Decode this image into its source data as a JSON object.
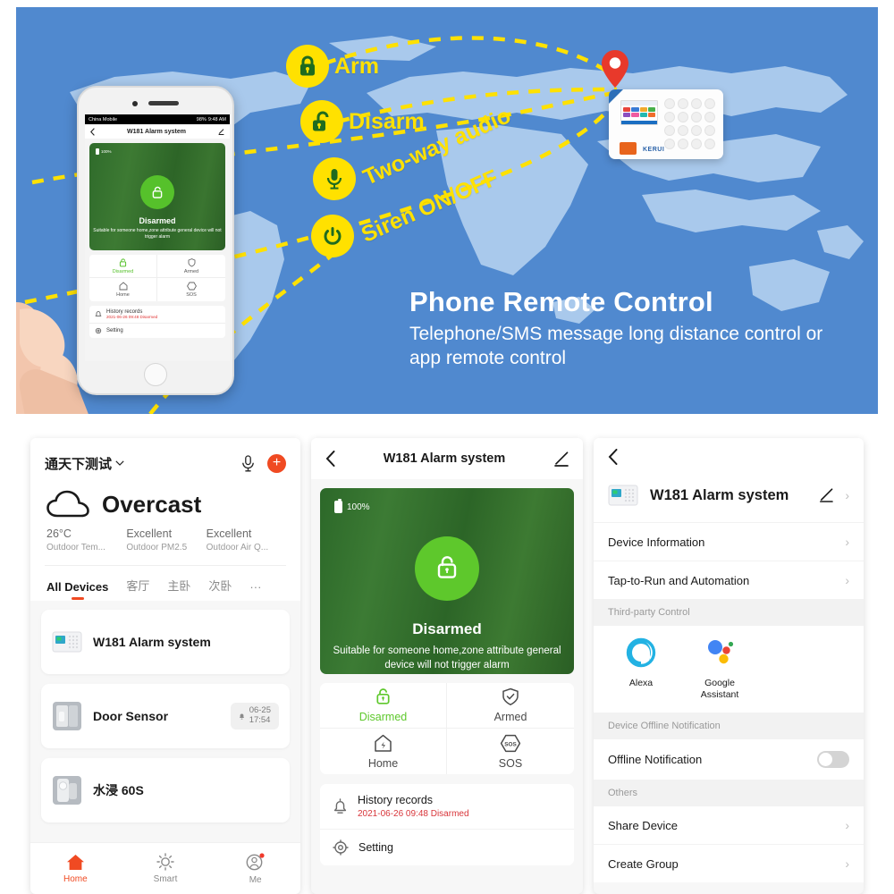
{
  "banner": {
    "title": "Phone Remote Control",
    "subtitle": "Telephone/SMS message long distance control or app remote control",
    "features": [
      {
        "label": "Arm",
        "icon": "lock-closed-icon"
      },
      {
        "label": "Disarm",
        "icon": "lock-open-icon"
      },
      {
        "label": "Two-way audio",
        "icon": "microphone-icon"
      },
      {
        "label": "Siren ON/OFF",
        "icon": "power-icon"
      }
    ],
    "product_brand": "KERUI",
    "phone_mock": {
      "carrier": "China Mobile",
      "battery": "98%",
      "time": "9:48 AM",
      "nav_title": "W181 Alarm system",
      "battery_level": "100%",
      "state": "Disarmed",
      "description": "Suitable for someone home,zone attribute general device will not trigger alarm",
      "modes": [
        "Disarmed",
        "Armed",
        "Home",
        "SOS"
      ],
      "history_title": "History records",
      "history_value": "2021-06-26 09:48 Disarmed",
      "setting": "Setting"
    }
  },
  "home": {
    "home_name": "通天下测试",
    "weather": "Overcast",
    "stats": [
      {
        "value": "26°C",
        "key": "Outdoor Tem..."
      },
      {
        "value": "Excellent",
        "key": "Outdoor PM2.5"
      },
      {
        "value": "Excellent",
        "key": "Outdoor Air Q..."
      }
    ],
    "tabs": [
      "All Devices",
      "客厅",
      "主卧",
      "次卧",
      "···"
    ],
    "active_tab": "All Devices",
    "devices": [
      {
        "name": "W181 Alarm system",
        "icon": "alarm-panel-icon",
        "badge": ""
      },
      {
        "name": "Door Sensor",
        "icon": "door-sensor-icon",
        "badge_date": "06-25",
        "badge_time": "17:54"
      },
      {
        "name": "水浸 60S",
        "icon": "water-sensor-icon",
        "badge": ""
      }
    ],
    "nav": [
      {
        "label": "Home",
        "icon": "home-icon",
        "active": true
      },
      {
        "label": "Smart",
        "icon": "sun-icon",
        "active": false
      },
      {
        "label": "Me",
        "icon": "person-icon",
        "active": false
      }
    ],
    "accent_color": "#f04a22"
  },
  "control": {
    "nav_title": "W181 Alarm system",
    "battery": "100%",
    "state": "Disarmed",
    "description": "Suitable for someone home,zone attribute general device will not trigger alarm",
    "modes": [
      {
        "label": "Disarmed",
        "icon": "lock-open-icon",
        "active": true
      },
      {
        "label": "Armed",
        "icon": "shield-check-icon",
        "active": false
      },
      {
        "label": "Home",
        "icon": "home-bolt-icon",
        "active": false
      },
      {
        "label": "SOS",
        "icon": "sos-icon",
        "active": false
      }
    ],
    "history_title": "History records",
    "history_value": "2021-06-26 09:48 Disarmed",
    "setting_label": "Setting",
    "active_color": "#5ec82c"
  },
  "settings": {
    "device_name": "W181 Alarm system",
    "rows": [
      {
        "label": "Device Information"
      },
      {
        "label": "Tap-to-Run and Automation"
      }
    ],
    "third_party_section": "Third-party Control",
    "third_party": [
      {
        "label": "Alexa",
        "icon": "alexa-icon"
      },
      {
        "label": "Google Assistant",
        "icon": "google-assistant-icon"
      }
    ],
    "offline_section": "Device Offline Notification",
    "offline_label": "Offline Notification",
    "offline_enabled": false,
    "others_section": "Others",
    "other_rows": [
      {
        "label": "Share Device"
      },
      {
        "label": "Create Group"
      }
    ]
  }
}
